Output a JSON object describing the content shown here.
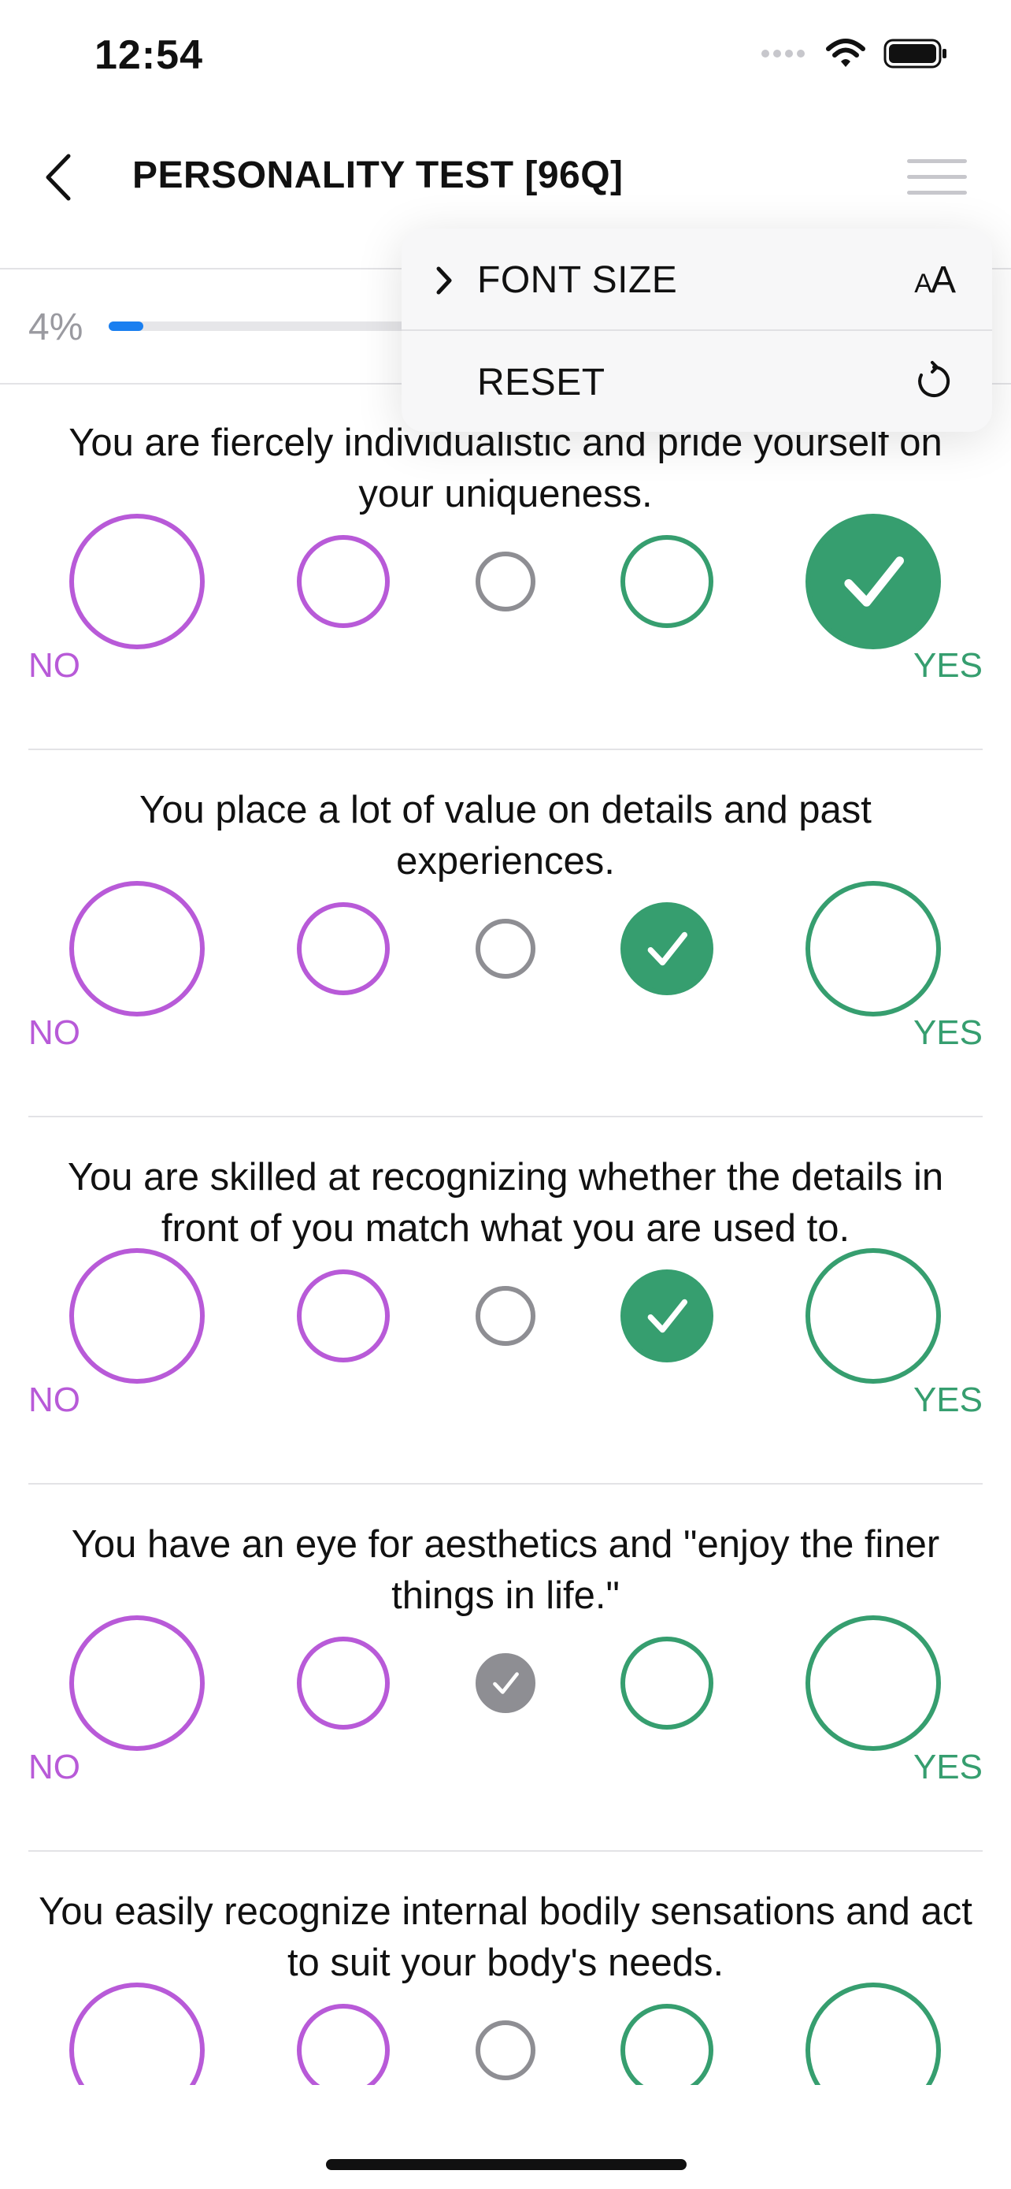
{
  "status_bar": {
    "time": "12:54"
  },
  "header": {
    "title": "PERSONALITY TEST [96Q]"
  },
  "progress": {
    "label": "4%",
    "value": 0.04
  },
  "menu": {
    "items": [
      {
        "label": "FONT SIZE",
        "icon": "font-size-icon",
        "icon_text_small": "A",
        "icon_text_large": "A"
      },
      {
        "label": "RESET",
        "icon": "reset-icon"
      }
    ]
  },
  "scale": {
    "no_label": "NO",
    "yes_label": "YES"
  },
  "questions": [
    {
      "text": "You are fiercely individualistic and pride yourself on your uniqueness.",
      "selected": 5
    },
    {
      "text": "You place a lot of value on details and past experiences.",
      "selected": 4
    },
    {
      "text": "You are skilled at recognizing whether the details in front of you match what you are used to.",
      "selected": 4
    },
    {
      "text": "You have an eye for aesthetics and \"enjoy the finer things in life.\"",
      "selected": 3
    },
    {
      "text": "You easily recognize internal bodily sensations and act to suit your body's needs.",
      "selected": 0
    }
  ],
  "colors": {
    "purple": "#b85ad8",
    "green": "#369e6f",
    "gray": "#8e8e93",
    "accent": "#1a7ff0"
  }
}
